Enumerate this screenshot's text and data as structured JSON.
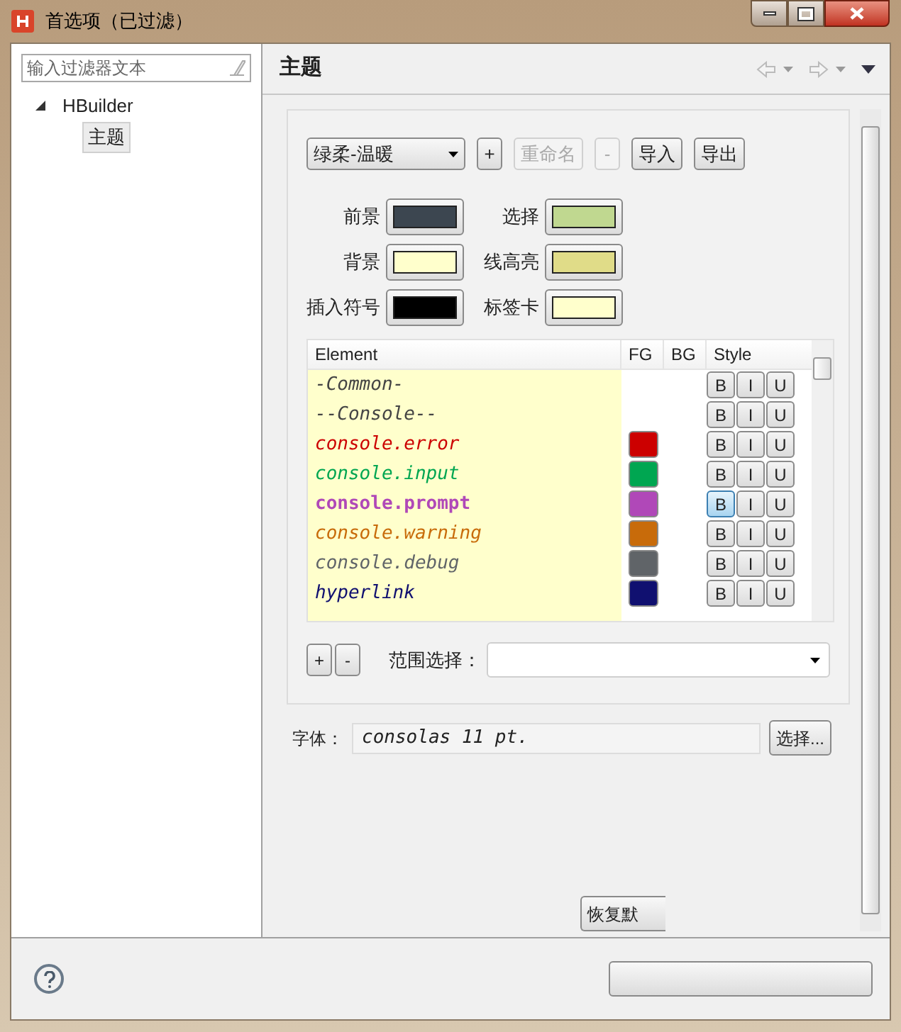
{
  "window": {
    "title": "首选项（已过滤）"
  },
  "sidebar": {
    "filter": {
      "placeholder": "输入过滤器文本"
    },
    "tree": [
      {
        "label": "HBuilder",
        "expanded": true,
        "selected": false,
        "children": [
          {
            "label": "主题",
            "selected": true
          }
        ]
      }
    ]
  },
  "page": {
    "title": "主题"
  },
  "theme": {
    "value": "绿柔-温暖"
  },
  "theme_buttons": [
    {
      "label": "+",
      "disabled": false
    },
    {
      "label": "重命名",
      "disabled": true
    },
    {
      "label": "-",
      "disabled": true
    },
    {
      "label": "导入",
      "disabled": false
    },
    {
      "label": "导出",
      "disabled": false
    }
  ],
  "colors": [
    {
      "label": "前景",
      "color": "#3c4650"
    },
    {
      "label": "选择",
      "color": "#c0d890"
    },
    {
      "label": "背景",
      "color": "#ffffcc"
    },
    {
      "label": "线高亮",
      "color": "#e0dc88"
    },
    {
      "label": "插入符号",
      "color": "#000000"
    },
    {
      "label": "标签卡",
      "color": "#ffffcc"
    }
  ],
  "table": {
    "columns": [
      "Element",
      "FG",
      "BG",
      "Style"
    ],
    "rows": [
      {
        "name": "-Common-",
        "color": "#444444",
        "fg_set": false,
        "bold": false,
        "italic": true,
        "style_buttons": [
          {
            "label": "B",
            "pressed": false
          },
          {
            "label": "I",
            "pressed": false
          },
          {
            "label": "U",
            "pressed": false
          }
        ]
      },
      {
        "name": "--Console--",
        "color": "#444444",
        "fg_set": false,
        "bold": false,
        "italic": true,
        "style_buttons": [
          {
            "label": "B",
            "pressed": false
          },
          {
            "label": "I",
            "pressed": false
          },
          {
            "label": "U",
            "pressed": false
          }
        ]
      },
      {
        "name": "console.error",
        "color": "#cc0000",
        "fg_set": true,
        "bold": false,
        "italic": true,
        "style_buttons": [
          {
            "label": "B",
            "pressed": false
          },
          {
            "label": "I",
            "pressed": false
          },
          {
            "label": "U",
            "pressed": false
          }
        ]
      },
      {
        "name": "console.input",
        "color": "#00a651",
        "fg_set": true,
        "bold": false,
        "italic": true,
        "style_buttons": [
          {
            "label": "B",
            "pressed": false
          },
          {
            "label": "I",
            "pressed": false
          },
          {
            "label": "U",
            "pressed": false
          }
        ]
      },
      {
        "name": "console.prompt",
        "color": "#b048b8",
        "fg_set": true,
        "bold": true,
        "italic": false,
        "style_buttons": [
          {
            "label": "B",
            "pressed": true
          },
          {
            "label": "I",
            "pressed": false
          },
          {
            "label": "U",
            "pressed": false
          }
        ]
      },
      {
        "name": "console.warning",
        "color": "#c86b0a",
        "fg_set": true,
        "bold": false,
        "italic": true,
        "style_buttons": [
          {
            "label": "B",
            "pressed": false
          },
          {
            "label": "I",
            "pressed": false
          },
          {
            "label": "U",
            "pressed": false
          }
        ]
      },
      {
        "name": "console.debug",
        "color": "#606468",
        "fg_set": true,
        "bold": false,
        "italic": true,
        "style_buttons": [
          {
            "label": "B",
            "pressed": false
          },
          {
            "label": "I",
            "pressed": false
          },
          {
            "label": "U",
            "pressed": false
          }
        ]
      },
      {
        "name": "hyperlink",
        "color": "#101070",
        "fg_set": true,
        "bold": false,
        "italic": true,
        "style_buttons": [
          {
            "label": "B",
            "pressed": false
          },
          {
            "label": "I",
            "pressed": false
          },
          {
            "label": "U",
            "pressed": false
          }
        ]
      }
    ]
  },
  "table_buttons": [
    "+",
    "-"
  ],
  "scope": {
    "label": "范围选择："
  },
  "font": {
    "label": "字体：",
    "value": "consolas 11 pt.",
    "button": "选择..."
  },
  "restore_button": "恢复默"
}
